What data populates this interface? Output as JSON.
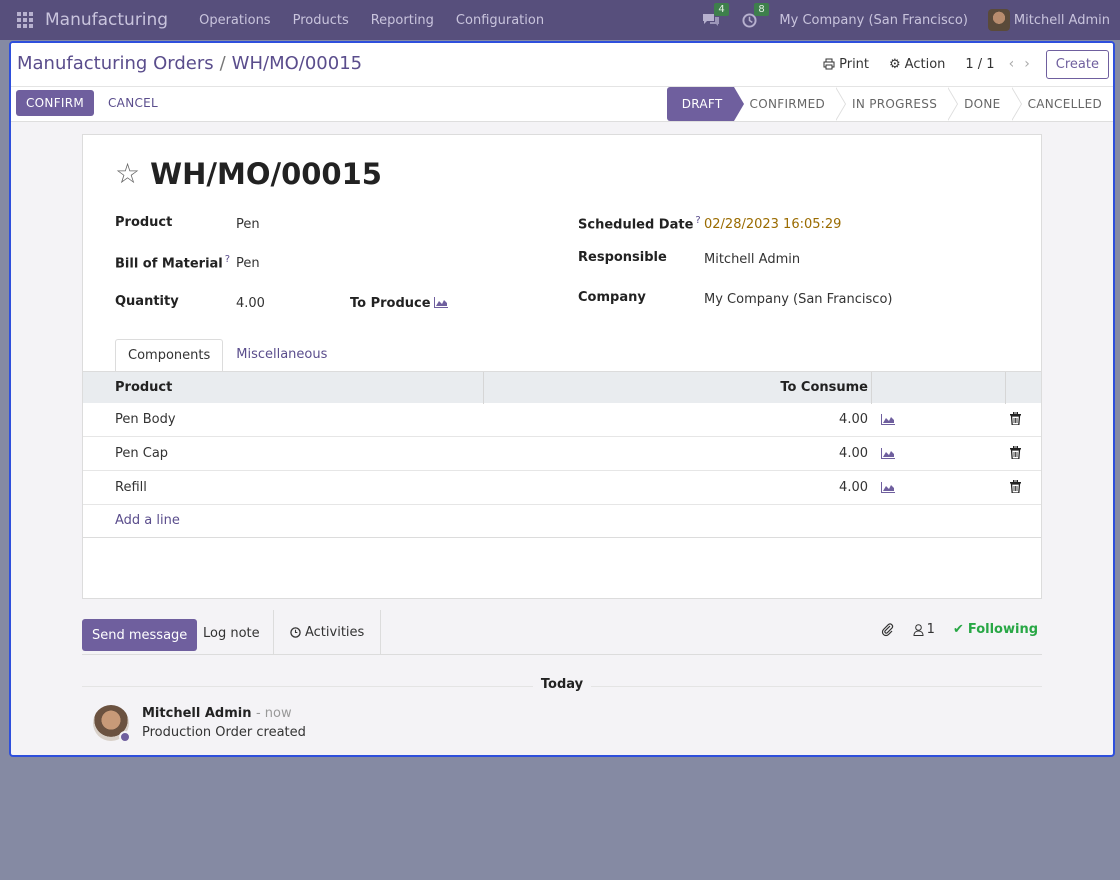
{
  "navbar": {
    "app_name": "Manufacturing",
    "menu": [
      "Operations",
      "Products",
      "Reporting",
      "Configuration"
    ],
    "messages_count": "4",
    "activities_count": "8",
    "company": "My Company (San Francisco)",
    "user": "Mitchell Admin"
  },
  "control_panel": {
    "breadcrumb_parent": "Manufacturing Orders",
    "breadcrumb_sep": "/",
    "breadcrumb_current": "WH/MO/00015",
    "print_label": "Print",
    "action_label": "Action",
    "pager": "1 / 1",
    "create_label": "Create",
    "confirm_label": "CONFIRM",
    "cancel_label": "CANCEL",
    "stages": [
      "DRAFT",
      "CONFIRMED",
      "IN PROGRESS",
      "DONE",
      "CANCELLED"
    ],
    "active_stage": "DRAFT"
  },
  "form": {
    "title": "WH/MO/00015",
    "product_label": "Product",
    "product_value": "Pen",
    "bom_label": "Bill of Material",
    "bom_value": "Pen",
    "quantity_label": "Quantity",
    "quantity_value": "4.00",
    "to_produce_label": "To Produce",
    "scheduled_label": "Scheduled Date",
    "scheduled_value": "02/28/2023 16:05:29",
    "responsible_label": "Responsible",
    "responsible_value": "Mitchell Admin",
    "company_label": "Company",
    "company_value": "My Company (San Francisco)",
    "help_mark": "?"
  },
  "tabs": [
    "Components",
    "Miscellaneous"
  ],
  "components": {
    "col_product": "Product",
    "col_consume": "To Consume",
    "rows": [
      {
        "product": "Pen Body",
        "qty": "4.00"
      },
      {
        "product": "Pen Cap",
        "qty": "4.00"
      },
      {
        "product": "Refill",
        "qty": "4.00"
      }
    ],
    "add_line": "Add a line"
  },
  "chatter": {
    "send_message": "Send message",
    "log_note": "Log note",
    "activities": "Activities",
    "followers_count": "1",
    "following": "Following",
    "today": "Today",
    "author": "Mitchell Admin",
    "time": "- now",
    "body": "Production Order created"
  },
  "colors": {
    "brand": "#574f7c",
    "primary": "#6f5f9e",
    "focus_border": "#2e4fdc",
    "date_warning": "#9a6b00",
    "following": "#28a745"
  }
}
